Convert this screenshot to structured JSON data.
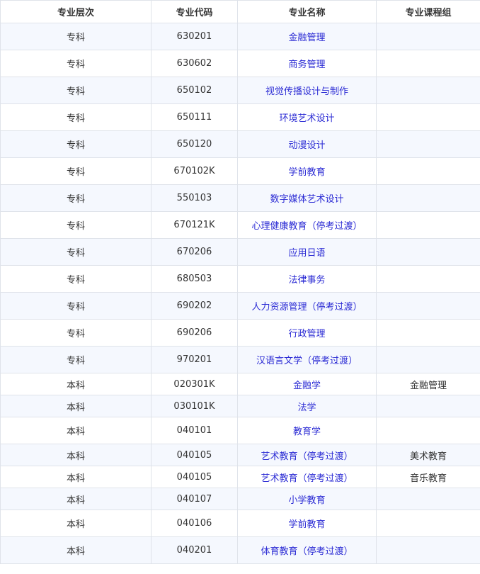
{
  "headers": [
    "专业层次",
    "专业代码",
    "专业名称",
    "专业课程组"
  ],
  "rows": [
    {
      "level": "专科",
      "code": "630201",
      "name": "金融管理",
      "group": "",
      "h": "row"
    },
    {
      "level": "专科",
      "code": "630602",
      "name": "商务管理",
      "group": "",
      "h": "row"
    },
    {
      "level": "专科",
      "code": "650102",
      "name": "视觉传播设计与制作",
      "group": "",
      "h": "row"
    },
    {
      "level": "专科",
      "code": "650111",
      "name": "环境艺术设计",
      "group": "",
      "h": "row"
    },
    {
      "level": "专科",
      "code": "650120",
      "name": "动漫设计",
      "group": "",
      "h": "row"
    },
    {
      "level": "专科",
      "code": "670102K",
      "name": "学前教育",
      "group": "",
      "h": "row"
    },
    {
      "level": "专科",
      "code": "550103",
      "name": "数字媒体艺术设计",
      "group": "",
      "h": "row"
    },
    {
      "level": "专科",
      "code": "670121K",
      "name": "心理健康教育（停考过渡）",
      "group": "",
      "h": "row"
    },
    {
      "level": "专科",
      "code": "670206",
      "name": "应用日语",
      "group": "",
      "h": "row"
    },
    {
      "level": "专科",
      "code": "680503",
      "name": "法律事务",
      "group": "",
      "h": "row"
    },
    {
      "level": "专科",
      "code": "690202",
      "name": "人力资源管理（停考过渡）",
      "group": "",
      "h": "row"
    },
    {
      "level": "专科",
      "code": "690206",
      "name": "行政管理",
      "group": "",
      "h": "row"
    },
    {
      "level": "专科",
      "code": "970201",
      "name": "汉语言文学（停考过渡）",
      "group": "",
      "h": "row"
    },
    {
      "level": "本科",
      "code": "020301K",
      "name": "金融学",
      "group": "金融管理",
      "h": "short"
    },
    {
      "level": "本科",
      "code": "030101K",
      "name": "法学",
      "group": "",
      "h": "short"
    },
    {
      "level": "本科",
      "code": "040101",
      "name": "教育学",
      "group": "",
      "h": "row"
    },
    {
      "level": "本科",
      "code": "040105",
      "name": "艺术教育（停考过渡）",
      "group": "美术教育",
      "h": "short"
    },
    {
      "level": "本科",
      "code": "040105",
      "name": "艺术教育（停考过渡）",
      "group": "音乐教育",
      "h": "short"
    },
    {
      "level": "本科",
      "code": "040107",
      "name": "小学教育",
      "group": "",
      "h": "short"
    },
    {
      "level": "本科",
      "code": "040106",
      "name": "学前教育",
      "group": "",
      "h": "row"
    },
    {
      "level": "本科",
      "code": "040201",
      "name": "体育教育（停考过渡）",
      "group": "",
      "h": "row"
    }
  ]
}
